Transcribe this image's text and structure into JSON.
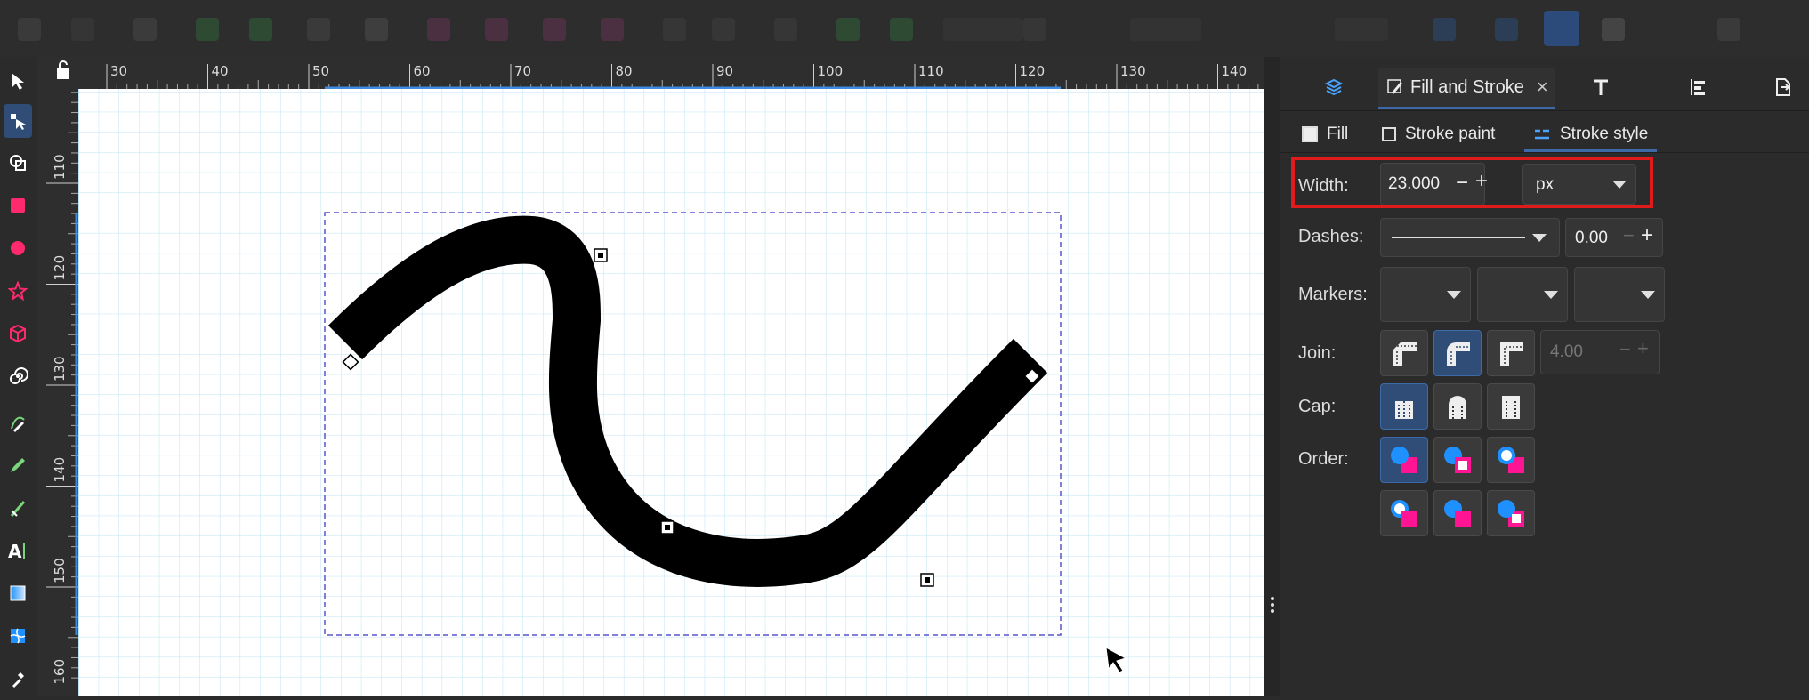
{
  "ruler": {
    "horizontal": [
      "30",
      "40",
      "50",
      "60",
      "70",
      "80",
      "90",
      "100",
      "110",
      "120",
      "130",
      "140"
    ],
    "vertical": [
      "110",
      "120",
      "130",
      "140",
      "150",
      "160"
    ]
  },
  "panel": {
    "tabs": [
      {
        "label": "Fill and Stroke",
        "close": "×"
      }
    ],
    "subtabs": {
      "fill": "Fill",
      "stroke_paint": "Stroke paint",
      "stroke_style": "Stroke style"
    },
    "width": {
      "label": "Width:",
      "value": "23.000",
      "minus": "−",
      "plus": "+",
      "unit": "px"
    },
    "dashes": {
      "label": "Dashes:",
      "offset": "0.00",
      "plus": "+"
    },
    "markers": {
      "label": "Markers:"
    },
    "join": {
      "label": "Join:",
      "miter_limit": "4.00"
    },
    "cap": {
      "label": "Cap:"
    },
    "order": {
      "label": "Order:"
    }
  },
  "colors": {
    "accent": "#3d6aa6",
    "highlight_box": "#e01b1b",
    "order_blue": "#1e90ff",
    "order_pink": "#ff1493"
  }
}
